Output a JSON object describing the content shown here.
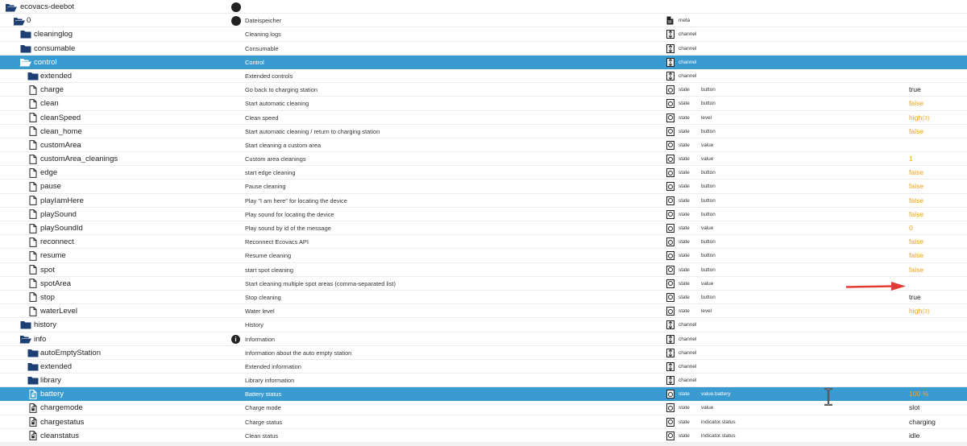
{
  "rows": [
    {
      "depth": 0,
      "icon": "folder-open",
      "name": "ecovacs-deebot",
      "mid": "dot",
      "desc": "",
      "ticon": "",
      "type": "",
      "role": "",
      "value": "",
      "value_color": "",
      "unit": "",
      "selected": false
    },
    {
      "depth": 1,
      "icon": "folder-open",
      "name": "0",
      "mid": "dot",
      "desc": "Dateispeicher",
      "ticon": "file",
      "type": "meta",
      "role": "",
      "value": "",
      "value_color": "",
      "unit": "",
      "selected": false
    },
    {
      "depth": 2,
      "icon": "folder",
      "name": "cleaninglog",
      "mid": "",
      "desc": "Cleaning logs",
      "ticon": "channel",
      "type": "channel",
      "role": "",
      "value": "",
      "value_color": "",
      "unit": "",
      "selected": false
    },
    {
      "depth": 2,
      "icon": "folder",
      "name": "consumable",
      "mid": "",
      "desc": "Consumable",
      "ticon": "channel",
      "type": "channel",
      "role": "",
      "value": "",
      "value_color": "",
      "unit": "",
      "selected": false
    },
    {
      "depth": 2,
      "icon": "folder-open",
      "name": "control",
      "mid": "",
      "desc": "Control",
      "ticon": "channel",
      "type": "channel",
      "role": "",
      "value": "",
      "value_color": "",
      "unit": "",
      "selected": true
    },
    {
      "depth": 3,
      "icon": "folder",
      "name": "extended",
      "mid": "",
      "desc": "Extended controls",
      "ticon": "channel",
      "type": "channel",
      "role": "",
      "value": "",
      "value_color": "",
      "unit": "",
      "selected": false
    },
    {
      "depth": 3,
      "icon": "file",
      "name": "charge",
      "mid": "",
      "desc": "Go back to charging station",
      "ticon": "state",
      "type": "state",
      "role": "button",
      "value": "true",
      "value_color": "dark",
      "unit": "",
      "selected": false
    },
    {
      "depth": 3,
      "icon": "file",
      "name": "clean",
      "mid": "",
      "desc": "Start automatic cleaning",
      "ticon": "state",
      "type": "state",
      "role": "button",
      "value": "false",
      "value_color": "orange",
      "unit": "",
      "selected": false
    },
    {
      "depth": 3,
      "icon": "file",
      "name": "cleanSpeed",
      "mid": "",
      "desc": "Clean speed",
      "ticon": "state",
      "type": "state",
      "role": "level",
      "value": "high",
      "value_color": "orange",
      "unit": "(3)",
      "selected": false
    },
    {
      "depth": 3,
      "icon": "file",
      "name": "clean_home",
      "mid": "",
      "desc": "Start automatic cleaning / return to charging station",
      "ticon": "state",
      "type": "state",
      "role": "button",
      "value": "false",
      "value_color": "orange",
      "unit": "",
      "selected": false
    },
    {
      "depth": 3,
      "icon": "file",
      "name": "customArea",
      "mid": "",
      "desc": "Start cleaning a custom area",
      "ticon": "state",
      "type": "state",
      "role": "value",
      "value": "",
      "value_color": "",
      "unit": "",
      "selected": false
    },
    {
      "depth": 3,
      "icon": "file",
      "name": "customArea_cleanings",
      "mid": "",
      "desc": "Custom area cleanings",
      "ticon": "state",
      "type": "state",
      "role": "value",
      "value": "1",
      "value_color": "orange",
      "unit": "",
      "selected": false
    },
    {
      "depth": 3,
      "icon": "file",
      "name": "edge",
      "mid": "",
      "desc": "start edge cleaning",
      "ticon": "state",
      "type": "state",
      "role": "button",
      "value": "false",
      "value_color": "orange",
      "unit": "",
      "selected": false
    },
    {
      "depth": 3,
      "icon": "file",
      "name": "pause",
      "mid": "",
      "desc": "Pause cleaning",
      "ticon": "state",
      "type": "state",
      "role": "button",
      "value": "false",
      "value_color": "orange",
      "unit": "",
      "selected": false
    },
    {
      "depth": 3,
      "icon": "file",
      "name": "playIamHere",
      "mid": "",
      "desc": "Play \"I am here\" for locating the device",
      "ticon": "state",
      "type": "state",
      "role": "button",
      "value": "false",
      "value_color": "orange",
      "unit": "",
      "selected": false
    },
    {
      "depth": 3,
      "icon": "file",
      "name": "playSound",
      "mid": "",
      "desc": "Play sound for locating the device",
      "ticon": "state",
      "type": "state",
      "role": "button",
      "value": "false",
      "value_color": "orange",
      "unit": "",
      "selected": false
    },
    {
      "depth": 3,
      "icon": "file",
      "name": "playSoundId",
      "mid": "",
      "desc": "Play sound by id of the message",
      "ticon": "state",
      "type": "state",
      "role": "value",
      "value": "0",
      "value_color": "orange",
      "unit": "",
      "selected": false
    },
    {
      "depth": 3,
      "icon": "file",
      "name": "reconnect",
      "mid": "",
      "desc": "Reconnect Ecovacs API",
      "ticon": "state",
      "type": "state",
      "role": "button",
      "value": "false",
      "value_color": "orange",
      "unit": "",
      "selected": false
    },
    {
      "depth": 3,
      "icon": "file",
      "name": "resume",
      "mid": "",
      "desc": "Resume cleaning",
      "ticon": "state",
      "type": "state",
      "role": "button",
      "value": "false",
      "value_color": "orange",
      "unit": "",
      "selected": false
    },
    {
      "depth": 3,
      "icon": "file",
      "name": "spot",
      "mid": "",
      "desc": "start spot cleaning",
      "ticon": "state",
      "type": "state",
      "role": "button",
      "value": "false",
      "value_color": "orange",
      "unit": "",
      "selected": false
    },
    {
      "depth": 3,
      "icon": "file",
      "name": "spotArea",
      "mid": "",
      "desc": "Start cleaning multiple spot areas (comma-separated list)",
      "ticon": "state",
      "type": "state",
      "role": "value",
      "value": "",
      "value_color": "",
      "unit": "",
      "selected": false
    },
    {
      "depth": 3,
      "icon": "file",
      "name": "stop",
      "mid": "",
      "desc": "Stop cleaning",
      "ticon": "state",
      "type": "state",
      "role": "button",
      "value": "true",
      "value_color": "dark",
      "unit": "",
      "selected": false
    },
    {
      "depth": 3,
      "icon": "file",
      "name": "waterLevel",
      "mid": "",
      "desc": "Water level",
      "ticon": "state",
      "type": "state",
      "role": "level",
      "value": "high",
      "value_color": "orange",
      "unit": "(3)",
      "selected": false
    },
    {
      "depth": 2,
      "icon": "folder",
      "name": "history",
      "mid": "",
      "desc": "History",
      "ticon": "channel",
      "type": "channel",
      "role": "",
      "value": "",
      "value_color": "",
      "unit": "",
      "selected": false
    },
    {
      "depth": 2,
      "icon": "folder-open",
      "name": "info",
      "mid": "info",
      "desc": "Information",
      "ticon": "channel",
      "type": "channel",
      "role": "",
      "value": "",
      "value_color": "",
      "unit": "",
      "selected": false
    },
    {
      "depth": 3,
      "icon": "folder",
      "name": "autoEmptyStation",
      "mid": "",
      "desc": "Information about the auto empty station",
      "ticon": "channel",
      "type": "channel",
      "role": "",
      "value": "",
      "value_color": "",
      "unit": "",
      "selected": false
    },
    {
      "depth": 3,
      "icon": "folder",
      "name": "extended",
      "mid": "",
      "desc": "Extended information",
      "ticon": "channel",
      "type": "channel",
      "role": "",
      "value": "",
      "value_color": "",
      "unit": "",
      "selected": false
    },
    {
      "depth": 3,
      "icon": "folder",
      "name": "library",
      "mid": "",
      "desc": "Library information",
      "ticon": "channel",
      "type": "channel",
      "role": "",
      "value": "",
      "value_color": "",
      "unit": "",
      "selected": false
    },
    {
      "depth": 3,
      "icon": "file-lock",
      "name": "battery",
      "mid": "",
      "desc": "Battery status",
      "ticon": "state",
      "type": "state",
      "role": "value.battery",
      "value": "100 %",
      "value_color": "orange",
      "unit": "",
      "selected": true
    },
    {
      "depth": 3,
      "icon": "file-lock",
      "name": "chargemode",
      "mid": "",
      "desc": "Charge mode",
      "ticon": "state",
      "type": "state",
      "role": "value",
      "value": "slot",
      "value_color": "dark",
      "unit": "",
      "selected": false
    },
    {
      "depth": 3,
      "icon": "file-lock",
      "name": "chargestatus",
      "mid": "",
      "desc": "Charge status",
      "ticon": "state",
      "type": "state",
      "role": "indicator.status",
      "value": "charging",
      "value_color": "dark",
      "unit": "",
      "selected": false
    },
    {
      "depth": 3,
      "icon": "file-lock",
      "name": "cleanstatus",
      "mid": "",
      "desc": "Clean status",
      "ticon": "state",
      "type": "state",
      "role": "indicator.status",
      "value": "idle",
      "value_color": "dark",
      "unit": "",
      "selected": false
    }
  ],
  "colors": {
    "selected_row": "#3a9bd1",
    "folder": "#1d3f73",
    "value_orange": "#f0a21c",
    "annotation_arrow": "#e53935"
  }
}
